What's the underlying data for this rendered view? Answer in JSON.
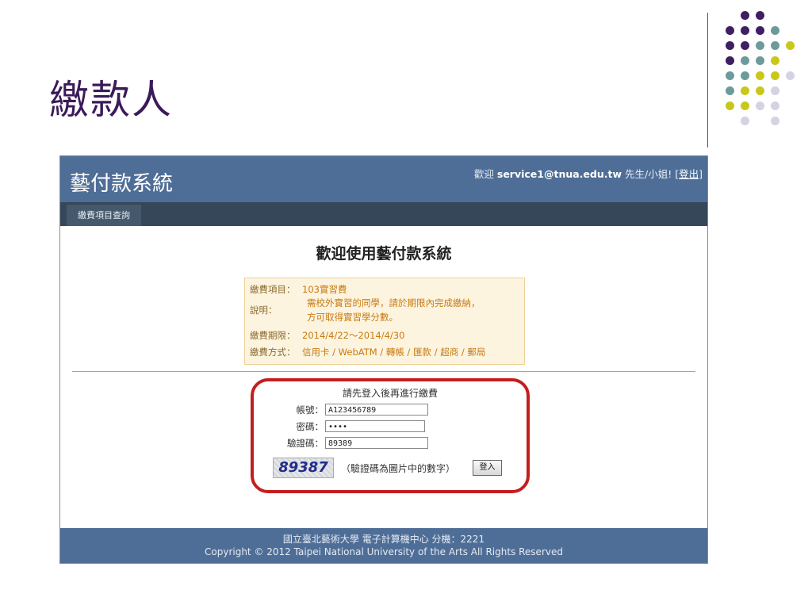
{
  "slide": {
    "title": "繳款人",
    "dot_colors": {
      "purple": "#3f1f63",
      "teal": "#6d9b9b",
      "yellow": "#c8c81a",
      "lavender": "#d3d3e3"
    }
  },
  "app": {
    "title": "藝付款系統",
    "welcome_prefix": "歡迎",
    "user_email": "service1@tnua.edu.tw",
    "welcome_suffix": "先生/小姐! [",
    "logout_label": "登出",
    "welcome_end": "]",
    "header_color": "#4f6e97",
    "nav_color": "#37475a"
  },
  "nav": {
    "tab_label": "繳費項目查詢"
  },
  "main": {
    "heading": "歡迎使用藝付款系統",
    "info": {
      "item_label": "繳費項目：",
      "item_value": "103實習費",
      "desc_label": "說明：",
      "desc_line1": "需校外實習的同學，請於期限內完成繳納，",
      "desc_line2": "方可取得實習學分數。",
      "period_label": "繳費期限：",
      "period_value": "2014/4/22～2014/4/30",
      "method_label": "繳費方式：",
      "method_value": "信用卡 / WebATM / 轉帳 / 匯款 / 超商 / 郵局"
    },
    "login": {
      "prompt": "請先登入後再進行繳費",
      "account_label": "帳號：",
      "account_value": "A123456789",
      "password_label": "密碼：",
      "password_value": "••••",
      "captcha_label": "驗證碼：",
      "captcha_input": "89389",
      "captcha_image_text": "89387",
      "captcha_hint": "（驗證碼為圖片中的數字）",
      "submit_label": "登入",
      "highlight_color": "#c41e1e"
    }
  },
  "footer": {
    "line1": "國立臺北藝術大學 電子計算機中心 分機：2221",
    "line2": "Copyright © 2012 Taipei National University of the Arts All Rights Reserved"
  }
}
